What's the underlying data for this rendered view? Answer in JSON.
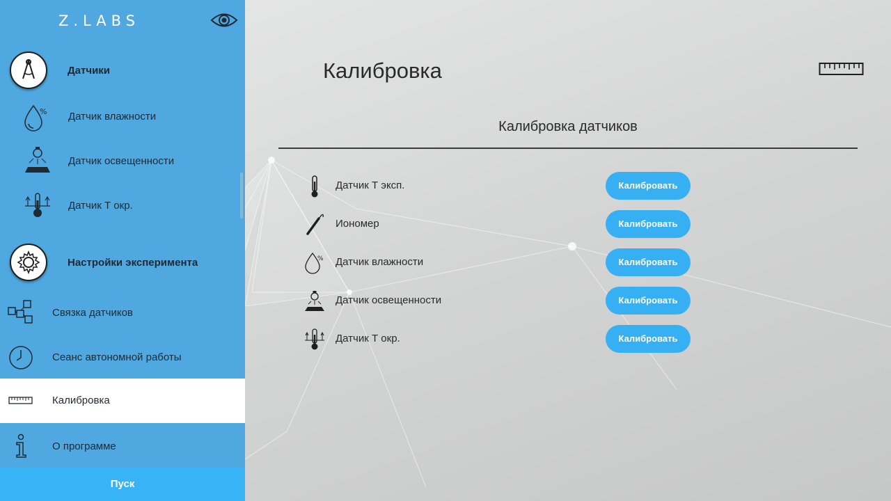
{
  "app": {
    "logo": "Z.LABS"
  },
  "sidebar": {
    "sections": [
      {
        "title": "Датчики",
        "icon": "caliper-icon"
      },
      {
        "title": "Настройки эксперимента",
        "icon": "gear-icon"
      }
    ],
    "sensor_items": [
      {
        "label": "Датчик влажности",
        "icon": "humidity-drop-icon"
      },
      {
        "label": "Датчик освещенности",
        "icon": "light-bulb-icon"
      },
      {
        "label": "Датчик Т окр.",
        "icon": "ambient-thermometer-icon"
      }
    ],
    "settings_items": [
      {
        "label": "Связка датчиков",
        "icon": "blocks-diagram-icon"
      },
      {
        "label": "Сеанс автономной работы",
        "icon": "clock-icon"
      },
      {
        "label": "Калибровка",
        "icon": "ruler-icon",
        "active": true
      },
      {
        "label": "О программе",
        "icon": "info-icon"
      }
    ],
    "start_label": "Пуск"
  },
  "main": {
    "title": "Калибровка",
    "section_heading": "Калибровка датчиков",
    "rows": [
      {
        "label": "Датчик Т эксп.",
        "icon": "thermometer-icon",
        "button": "Калибровать"
      },
      {
        "label": "Иономер",
        "icon": "ionometer-probe-icon",
        "button": "Калибровать"
      },
      {
        "label": "Датчик влажности",
        "icon": "humidity-drop-icon",
        "button": "Калибровать"
      },
      {
        "label": "Датчик освещенности",
        "icon": "light-bulb-icon",
        "button": "Калибровать"
      },
      {
        "label": "Датчик Т окр.",
        "icon": "ambient-thermometer-icon",
        "button": "Калибровать"
      }
    ]
  },
  "colors": {
    "sidebar_bg": "#4fa8df",
    "accent_button": "#36b0f3",
    "start_button": "#38b3f5",
    "active_item_bg": "#ffffff"
  }
}
